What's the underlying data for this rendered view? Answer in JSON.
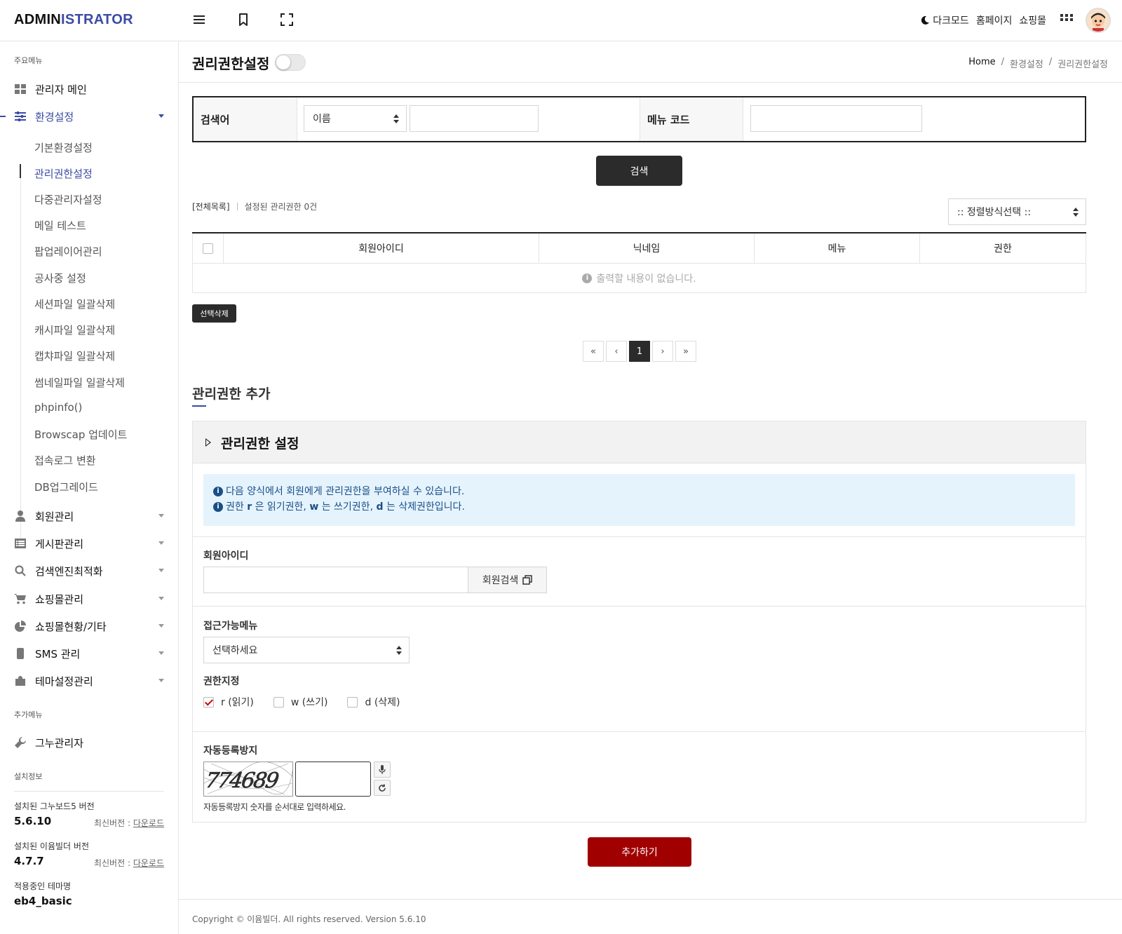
{
  "brand": {
    "part1": "ADMIN",
    "part2": "ISTRATOR",
    "accent": "#3b4ba4"
  },
  "topbar": {
    "icons": [
      "menu-icon",
      "bookmark-icon",
      "fullscreen-icon"
    ],
    "dark_mode": "다크모드",
    "homepage": "홈페이지",
    "shop": "쇼핑몰",
    "apps_icon": "grid-icon"
  },
  "sidebar": {
    "main_section": "주요메뉴",
    "items": [
      {
        "label": "관리자 메인",
        "icon": "dashboard-icon"
      },
      {
        "label": "환경설정",
        "icon": "sliders-icon",
        "active": true
      },
      {
        "label": "회원관리",
        "icon": "user-icon"
      },
      {
        "label": "게시판관리",
        "icon": "list-icon"
      },
      {
        "label": "검색엔진최적화",
        "icon": "search-icon"
      },
      {
        "label": "쇼핑몰관리",
        "icon": "cart-icon"
      },
      {
        "label": "쇼핑몰현황/기타",
        "icon": "pie-chart-icon"
      },
      {
        "label": "SMS 관리",
        "icon": "mobile-icon"
      },
      {
        "label": "테마설정관리",
        "icon": "puzzle-icon"
      }
    ],
    "sub_items": [
      "기본환경설정",
      "관리권한설정",
      "다중관리자설정",
      "메일 테스트",
      "팝업레이어관리",
      "공사중 설정",
      "세션파일 일괄삭제",
      "캐시파일 일괄삭제",
      "캡챠파일 일괄삭제",
      "썸네일파일 일괄삭제",
      "phpinfo()",
      "Browscap 업데이트",
      "접속로그 변환",
      "DB업그레이드"
    ],
    "extra_section": "추가메뉴",
    "extra_item": "그누관리자",
    "install_section": "설치정보",
    "install": [
      {
        "label": "설치된 그누보드5 버전",
        "value": "5.6.10",
        "latest": "최신버전 :",
        "link": "다운로드"
      },
      {
        "label": "설치된 이윰빌더 버전",
        "value": "4.7.7",
        "latest": "최신버전 :",
        "link": "다운로드"
      },
      {
        "label": "적용중인 테마명",
        "value": "eb4_basic"
      }
    ]
  },
  "page": {
    "title": "권리권한설정",
    "breadcrumb": [
      "Home",
      "/",
      "환경설정",
      "/",
      "권리권한설정"
    ]
  },
  "search": {
    "keyword_label": "검색어",
    "field_select": "이름",
    "menu_code_label": "메뉴 코드",
    "button": "검색"
  },
  "list": {
    "all": "[전체목록]",
    "count_text": "설정된 관리권한 0건",
    "sort_select": ":: 정렬방식선택 ::",
    "columns": [
      "회원아이디",
      "닉네임",
      "메뉴",
      "권한"
    ],
    "empty": "출력할 내용이 없습니다.",
    "delete_button": "선택삭제"
  },
  "pagination": {
    "first": "«",
    "prev": "‹",
    "current": "1",
    "next": "›",
    "last": "»"
  },
  "add": {
    "title": "관리권한 추가",
    "panel_title": "관리권한 설정",
    "notice": {
      "line1": "다음 양식에서 회원에게 관리권한을 부여하실 수 있습니다.",
      "line2_a": "권한 ",
      "r": "r",
      "line2_b": " 은 읽기권한, ",
      "w": "w",
      "line2_c": " 는 쓰기권한, ",
      "d": "d",
      "line2_d": " 는 삭제권한입니다."
    },
    "member_id_label": "회원아이디",
    "member_search_button": "회원검색",
    "menu_label": "접근가능메뉴",
    "menu_select": "선택하세요",
    "perm_label": "권한지정",
    "perms": [
      {
        "label": "r (읽기)",
        "checked": true
      },
      {
        "label": "w (쓰기)",
        "checked": false
      },
      {
        "label": "d (삭제)",
        "checked": false
      }
    ],
    "captcha_label": "자동등록방지",
    "captcha_code": "774689",
    "captcha_help": "자동등록방지 숫자를 순서대로 입력하세요.",
    "submit": "추가하기"
  },
  "footer": "Copyright © 이윰빌더. All rights reserved. Version 5.6.10"
}
